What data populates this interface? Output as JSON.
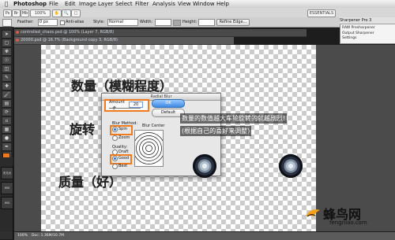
{
  "menu": {
    "app_name": "Photoshop",
    "items": [
      "File",
      "Edit",
      "Image",
      "Layer",
      "Select",
      "Filter",
      "Analysis",
      "View",
      "Window",
      "Help"
    ]
  },
  "appbar": {
    "zoom": "100%",
    "workspace": "ESSENTIALS"
  },
  "options": {
    "feather_label": "Feather:",
    "feather_value": "0 px",
    "anti_alias_label": "Anti-alias",
    "style_label": "Style:",
    "style_value": "Normal",
    "width_label": "Width:",
    "height_label": "Height:",
    "refine_edge": "Refine Edge..."
  },
  "documents": {
    "tab1": "controlled_chaos.psd @ 100% (Layer 7, RGB/8)",
    "tab2": "20000.psd @ 16.7% (Background copy 3, RGB/8)"
  },
  "dialog": {
    "title": "Radial Blur",
    "amount_label": "Amount",
    "amount_value": "20",
    "ok": "OK",
    "default": "Default",
    "blur_method_label": "Blur Method:",
    "spin": "Spin",
    "zoom": "Zoom",
    "quality_label": "Quality:",
    "draft": "Draft",
    "good": "Good",
    "best": "Best",
    "blur_center": "Blur Center"
  },
  "annotations": {
    "amount": "数量（模糊程度）",
    "rotation": "旋转",
    "quality": "质量（好）",
    "note_line1": "数量的数值越大车轮旋转的就越剧烈!",
    "note_line2": "(根据自己的喜好来调整)"
  },
  "right_panel": {
    "header": "Sharpener Pro 3",
    "line1": "RAW Presharpener",
    "line2": "Output Sharpener",
    "line3": "Settings"
  },
  "status": {
    "zoom": "100%",
    "doc": "Doc: 1.36M/10.7M"
  },
  "left_widgets": [
    {
      "label": "天元大"
    },
    {
      "label": "IMG"
    },
    {
      "label": "IMG"
    }
  ],
  "branding": {
    "logo_text": "蜂鸟网",
    "url": "fengniao.com"
  }
}
